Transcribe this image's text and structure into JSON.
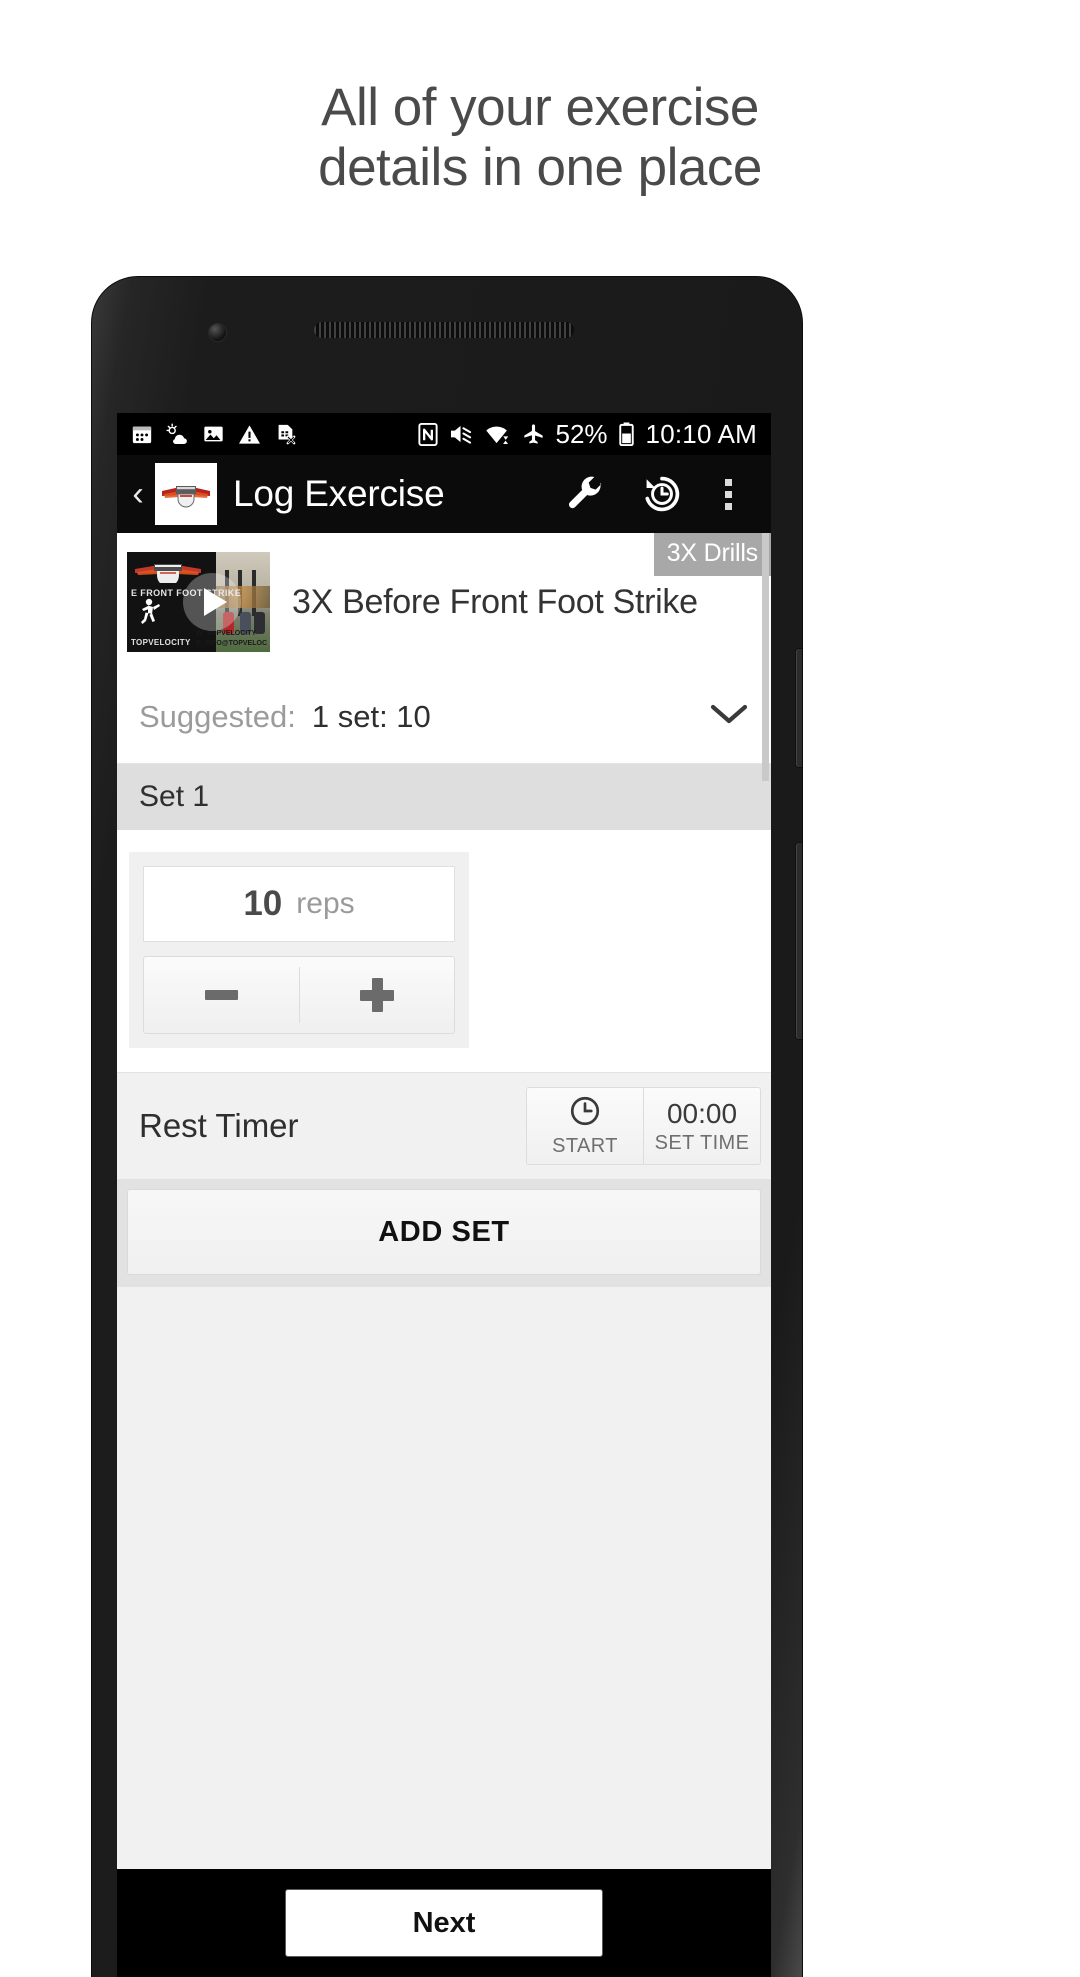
{
  "headline": {
    "line1": "All of your exercise",
    "line2": "details in one place"
  },
  "status_bar": {
    "left_icons": [
      "calendar-icon",
      "weather-icon",
      "photo-icon",
      "warning-icon",
      "sim-removed-icon"
    ],
    "right_icons": [
      "nfc-icon",
      "volume-mute-icon",
      "wifi-icon",
      "airplane-mode-icon",
      "battery-icon"
    ],
    "battery_percent": "52%",
    "time": "10:10 AM"
  },
  "app_bar": {
    "back_label": "‹",
    "logo_name": "topvelocity-logo",
    "title": "Log Exercise",
    "actions": [
      {
        "name": "wrench-icon",
        "label": "Settings"
      },
      {
        "name": "history-icon",
        "label": "History"
      },
      {
        "name": "overflow-menu-icon",
        "label": "More options"
      }
    ]
  },
  "exercise": {
    "badge": "3X Drills",
    "title": "3X Before Front Foot Strike",
    "thumbnail": {
      "brand": "TOPVELOCITY",
      "overlay_title": "E FRONT FOOT STRIKE",
      "footer_brand": "TOPVELOCITY",
      "contact_line1": "W: TOPVELOCITY",
      "contact_line2": "E: INFO@TOPVELOC",
      "play_icon": "play-icon"
    },
    "suggested_label": "Suggested:",
    "suggested_value": "1 set: 10",
    "expand_icon": "chevron-down-icon"
  },
  "set": {
    "header": "Set 1",
    "reps_value": "10",
    "reps_unit": "reps",
    "decrement_icon": "minus-icon",
    "increment_icon": "plus-icon"
  },
  "rest_timer": {
    "label": "Rest Timer",
    "start_icon": "clock-icon",
    "start_label": "START",
    "time_value": "00:00",
    "time_label": "SET TIME"
  },
  "actions": {
    "add_set": "ADD SET",
    "next": "Next"
  },
  "colors": {
    "accent_red": "#c0392b",
    "app_bar_bg": "#0b0b0b",
    "badge_bg": "#a8a8a8",
    "screen_bg": "#f1f1f1"
  }
}
